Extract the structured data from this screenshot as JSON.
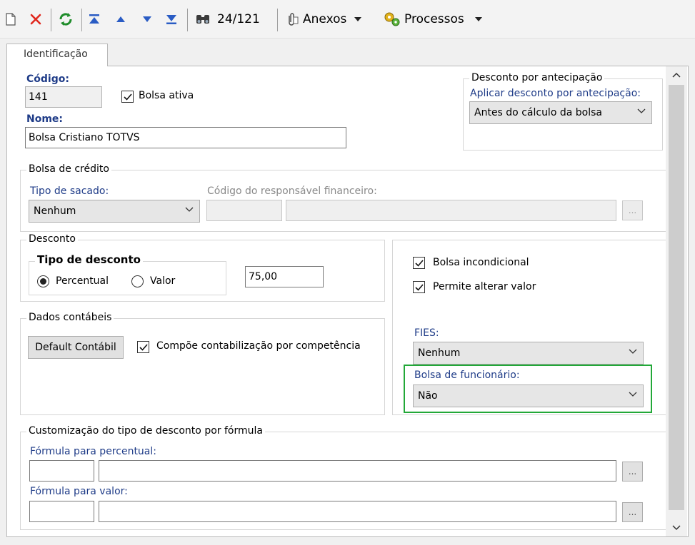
{
  "toolbar": {
    "record_counter": "24/121",
    "attachments_label": "Anexos",
    "processes_label": "Processos"
  },
  "tab": {
    "label": "Identificação"
  },
  "codigo": {
    "label": "Código:",
    "value": "141"
  },
  "bolsa_ativa": {
    "label": "Bolsa ativa",
    "checked": true
  },
  "nome": {
    "label": "Nome:",
    "value": "Bolsa Cristiano TOTVS"
  },
  "desconto_antecipacao": {
    "title": "Desconto por antecipação",
    "field_label": "Aplicar desconto por antecipação:",
    "selected": "Antes do cálculo da bolsa"
  },
  "bolsa_credito": {
    "title": "Bolsa de crédito",
    "tipo_sacado_label": "Tipo de sacado:",
    "tipo_sacado_selected": "Nenhum",
    "codigo_responsavel_label": "Código do responsável financeiro:",
    "browse_label": "..."
  },
  "desconto": {
    "title": "Desconto",
    "tipo_title": "Tipo de desconto",
    "percentual_label": "Percentual",
    "valor_label": "Valor",
    "selected": "Percentual",
    "value": "75,00"
  },
  "flags": {
    "bolsa_incondicional_label": "Bolsa incondicional",
    "permite_alterar_label": "Permite alterar valor"
  },
  "fies": {
    "label": "FIES:",
    "selected": "Nenhum"
  },
  "bolsa_funcionario": {
    "label": "Bolsa de funcionário:",
    "selected": "Não"
  },
  "dados_contabeis": {
    "title": "Dados contábeis",
    "default_button": "Default Contábil",
    "competencia_label": "Compõe contabilização por competência"
  },
  "customizacao": {
    "title": "Customização do tipo de desconto por fórmula",
    "percentual_label": "Fórmula para percentual:",
    "valor_label": "Fórmula para valor:",
    "browse_label": "..."
  },
  "colors": {
    "highlight": "#22a838",
    "select_bg": "#e6e6e6"
  }
}
